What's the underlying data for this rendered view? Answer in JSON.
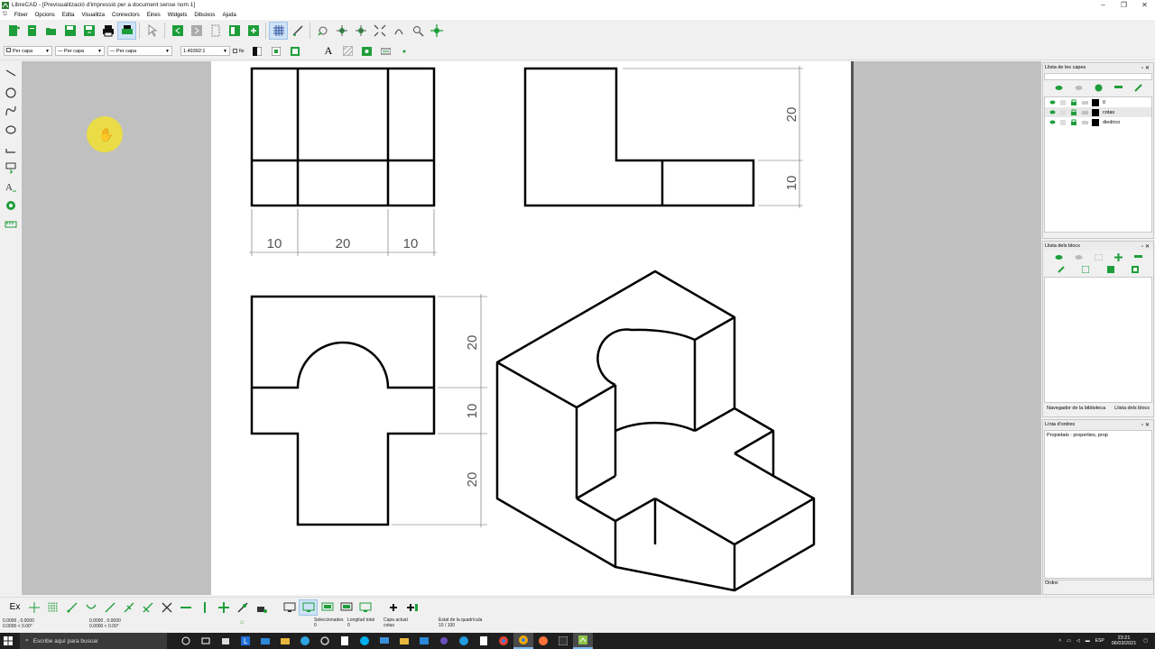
{
  "window": {
    "title": "LibreCAD - [Previsualització d'impressió per a document sense nom 1]"
  },
  "menu": [
    "Fitxer",
    "Opcions",
    "Edita",
    "Visualitza",
    "Connectors",
    "Eines",
    "Widgets",
    "Dibuixos",
    "Ajuda"
  ],
  "pen_toolbar": {
    "color": "Per capa",
    "linetype": "Per capa",
    "width": "Per capa",
    "scale": "1.49392:1",
    "fix_label": "fix"
  },
  "drawing": {
    "front_dims": [
      "10",
      "20",
      "10"
    ],
    "side_dims": [
      "20",
      "10"
    ],
    "top_dims": [
      "20",
      "10",
      "20"
    ]
  },
  "layers_dock": {
    "title": "Llista de les capes",
    "layers": [
      "0",
      "cotas",
      "diedrico"
    ]
  },
  "blocks_dock": {
    "title": "Llista dels blocs",
    "tabs": [
      "Navegador de la biblioteca",
      "Llista dels blocs"
    ]
  },
  "command_dock": {
    "title": "Línia d'ordres",
    "text": "Propietats : properties, prop",
    "prompt": "Ordre:"
  },
  "snap_label": "Ex",
  "status": {
    "coord_abs": "0.0000 , 0.0000",
    "coord_abs_polar": "0.0000 < 0.00°",
    "coord_rel": "0.0000 , 0.0000",
    "coord_rel_polar": "0.0000 < 0.00°",
    "selected_label": "Seleccionades",
    "selected_value": "0",
    "length_label": "Longitud total",
    "length_value": "0",
    "layer_label": "Capa actual",
    "layer_value": "cotas",
    "grid_label": "Estat de la quadrícula",
    "grid_value": "10 / 100"
  },
  "taskbar": {
    "search_placeholder": "Escribe aquí para buscar",
    "lang": "ESP",
    "time": "23:21",
    "date": "06/03/2021"
  },
  "colors": {
    "accent_green": "#1e9e3a",
    "paper": "#ffffff",
    "workspace": "#c0c0c0"
  }
}
